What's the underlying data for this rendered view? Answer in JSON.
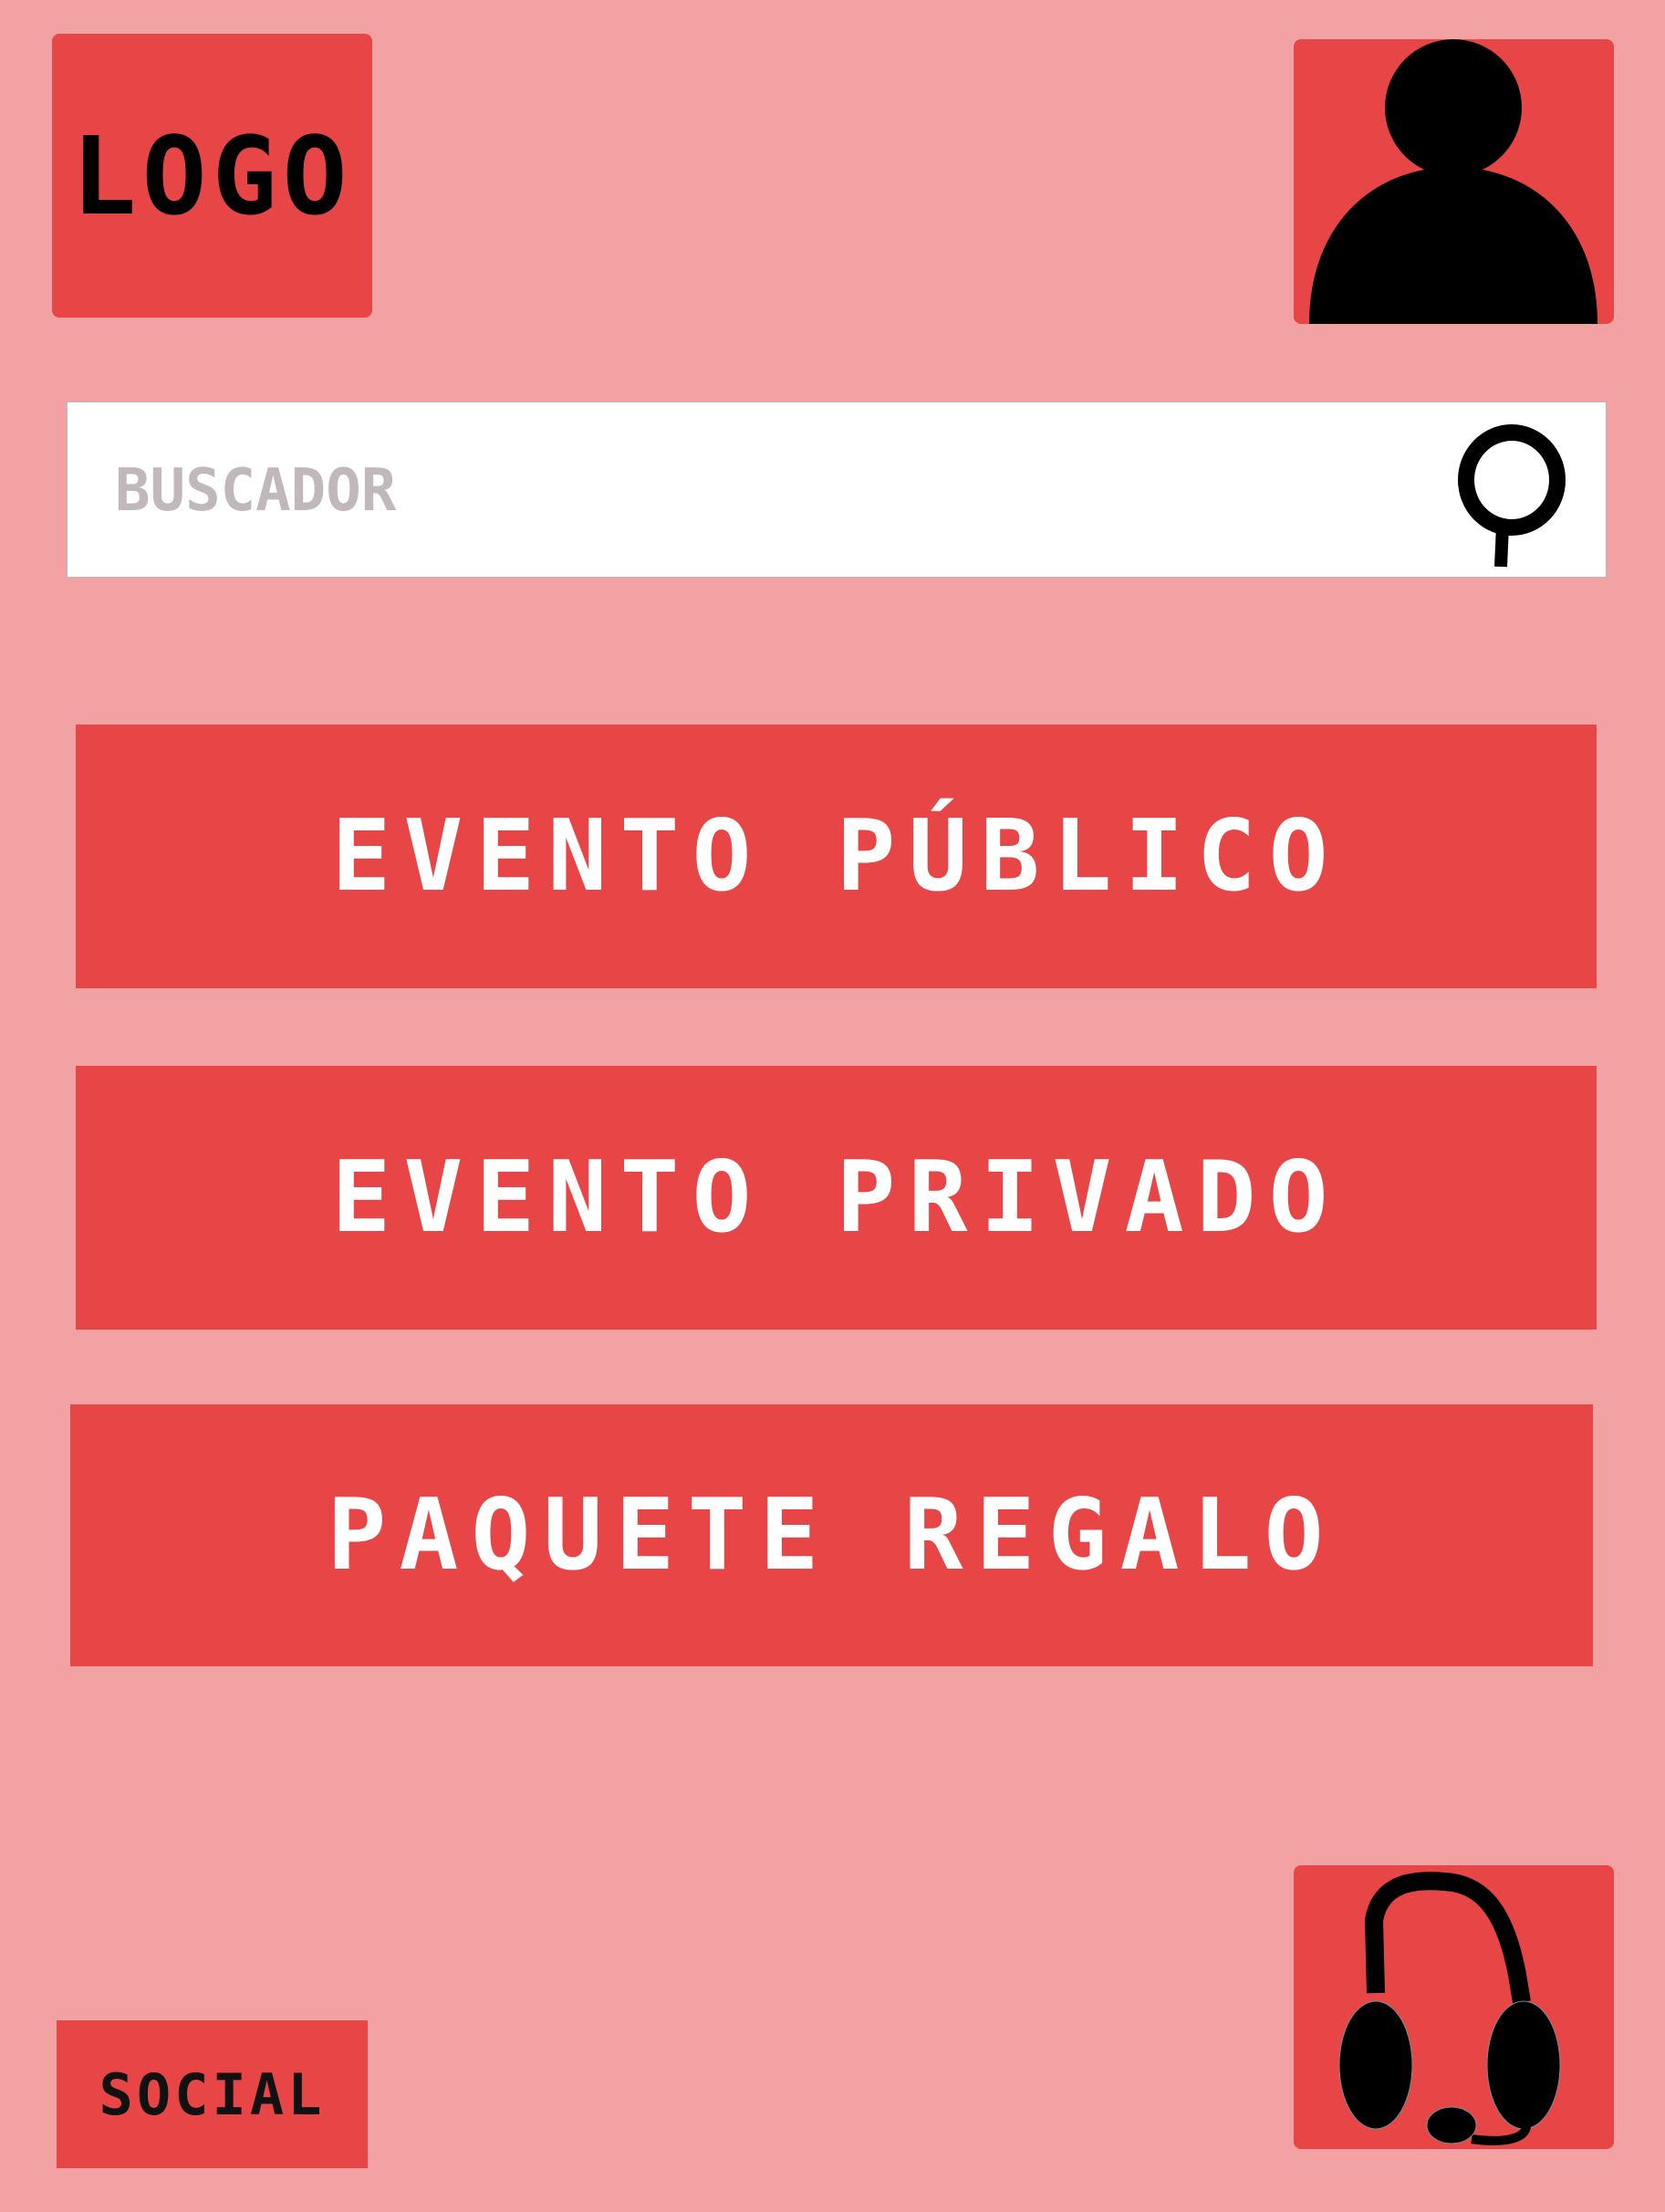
{
  "header": {
    "logo_text": "LOGO",
    "avatar_icon": "user-icon"
  },
  "search": {
    "placeholder": "BUSCADOR",
    "value": "",
    "icon": "search-icon"
  },
  "menu": {
    "items": [
      {
        "label": "EVENTO PÚBLICO"
      },
      {
        "label": "EVENTO PRIVADO"
      },
      {
        "label": "PAQUETE REGALO"
      }
    ]
  },
  "footer": {
    "social_label": "SOCIAL",
    "support_icon": "headset-icon"
  },
  "colors": {
    "background": "#f2a2a2",
    "accent": "#e84646",
    "button_text": "#ffffff"
  }
}
